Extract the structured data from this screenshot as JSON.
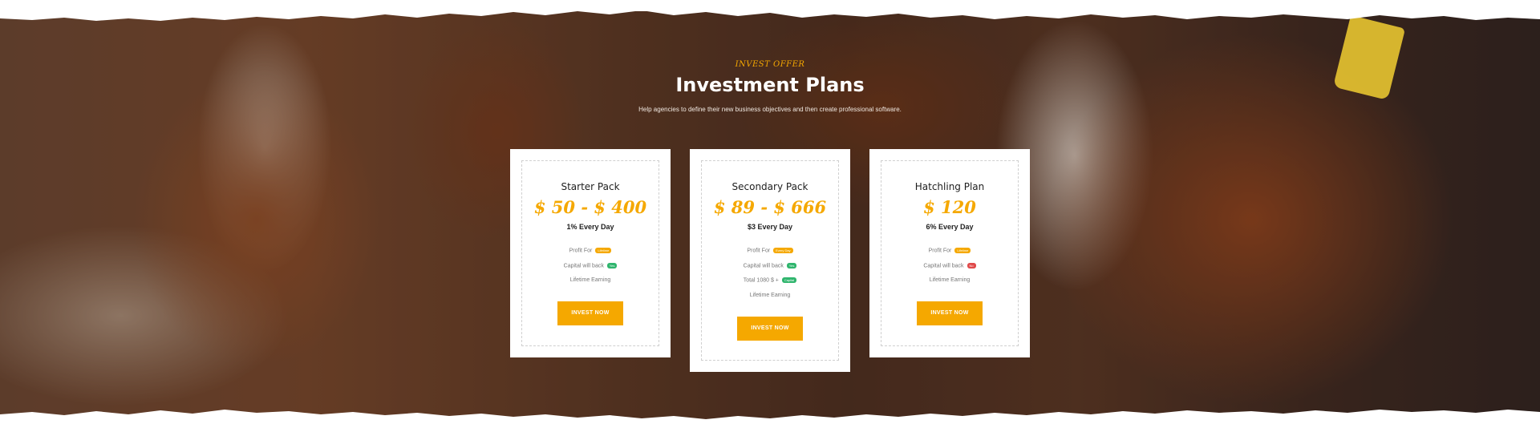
{
  "section": {
    "eyebrow": "INVEST OFFER",
    "title": "Investment Plans",
    "subtitle": "Help agencies to define their new business objectives and then create professional software."
  },
  "plans": [
    {
      "name": "Starter Pack",
      "price": "$ 50 - $ 400",
      "rate": "1% Every Day",
      "features": [
        {
          "text": "Profit For",
          "badge": "Lifetime",
          "badge_color": "#f5a800"
        },
        {
          "text": "Capital will back",
          "badge": "Yes",
          "badge_color": "#2fb56d"
        },
        {
          "text": "Lifetime Earning",
          "badge": "",
          "badge_color": ""
        }
      ],
      "button": "INVEST NOW"
    },
    {
      "name": "Secondary Pack",
      "price": "$ 89 - $ 666",
      "rate": "$3 Every Day",
      "features": [
        {
          "text": "Profit For",
          "badge": "Every Day",
          "badge_color": "#f5a800"
        },
        {
          "text": "Capital will back",
          "badge": "Yes",
          "badge_color": "#2fb56d"
        },
        {
          "text": "Total 1080 $ +",
          "badge": "Capital",
          "badge_color": "#2fb56d"
        },
        {
          "text": "Lifetime Earning",
          "badge": "",
          "badge_color": ""
        }
      ],
      "button": "INVEST NOW"
    },
    {
      "name": "Hatchling Plan",
      "price": "$ 120",
      "rate": "6% Every Day",
      "features": [
        {
          "text": "Profit For",
          "badge": "Lifetime",
          "badge_color": "#f5a800"
        },
        {
          "text": "Capital will back",
          "badge": "No",
          "badge_color": "#e0494a"
        },
        {
          "text": "Lifetime Earning",
          "badge": "",
          "badge_color": ""
        }
      ],
      "button": "INVEST NOW"
    }
  ],
  "colors": {
    "accent": "#f5a800",
    "badge_yes": "#2fb56d",
    "badge_no": "#e0494a"
  }
}
